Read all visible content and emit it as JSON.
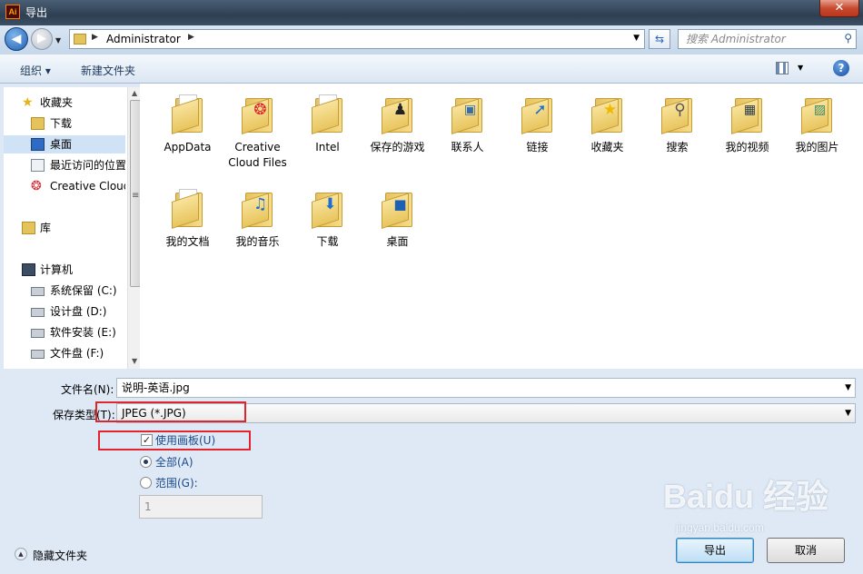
{
  "window": {
    "title": "导出",
    "app_icon_text": "Ai",
    "close_glyph": "✕"
  },
  "address_bar": {
    "crumb": "Administrator",
    "search_placeholder": "搜索 Administrator"
  },
  "toolbar": {
    "organize": "组织 ▾",
    "new_folder": "新建文件夹",
    "help": "?"
  },
  "nav_pane": {
    "favorites_header": "收藏夹",
    "favorites": [
      "下载",
      "桌面",
      "最近访问的位置",
      "Creative Cloud"
    ],
    "libraries": "库",
    "computer_header": "计算机",
    "drives": [
      "系统保留 (C:)",
      "设计盘 (D:)",
      "软件安装 (E:)",
      "文件盘 (F:)"
    ]
  },
  "files": [
    {
      "name": "AppData",
      "icon": "folder-icon"
    },
    {
      "name": "Creative Cloud Files",
      "icon": "creative-cloud-icon"
    },
    {
      "name": "Intel",
      "icon": "folder-icon"
    },
    {
      "name": "保存的游戏",
      "icon": "chess-icon"
    },
    {
      "name": "联系人",
      "icon": "contacts-icon"
    },
    {
      "name": "链接",
      "icon": "link-arrow-icon"
    },
    {
      "name": "收藏夹",
      "icon": "star-icon"
    },
    {
      "name": "搜索",
      "icon": "search-icon"
    },
    {
      "name": "我的视频",
      "icon": "film-icon"
    },
    {
      "name": "我的图片",
      "icon": "picture-icon"
    },
    {
      "name": "我的文档",
      "icon": "document-icon"
    },
    {
      "name": "我的音乐",
      "icon": "music-icon"
    },
    {
      "name": "下载",
      "icon": "download-icon"
    },
    {
      "name": "桌面",
      "icon": "desktop-icon"
    }
  ],
  "form": {
    "filename_label": "文件名(N):",
    "filename_value": "说明-英语.jpg",
    "filetype_label": "保存类型(T):",
    "filetype_value": "JPEG (*.JPG)",
    "use_artboards": "使用画板(U)",
    "all": "全部(A)",
    "range": "范围(G):",
    "range_value": "1",
    "hide_folders": "隐藏文件夹",
    "export_button": "导出",
    "cancel_button": "取消"
  },
  "watermark": {
    "text": "Baidu 经验",
    "sub": "jingyan.baidu.com"
  }
}
